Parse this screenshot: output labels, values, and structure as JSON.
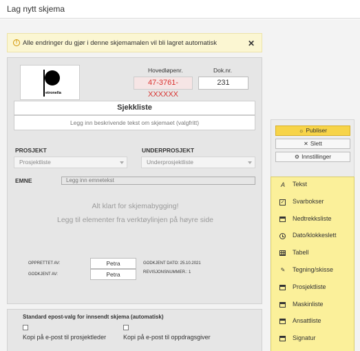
{
  "window": {
    "title": "Lag nytt skjema"
  },
  "notice": {
    "text": "Alle endringer du gjør i denne skjemamalen vil bli lagret automatisk",
    "close": "✕"
  },
  "form": {
    "logo_text": "etronella",
    "hovedlopenr_label": "Hovedløpenr.",
    "hovedlopenr_value": "47-3761-XXXXXX",
    "doknr_label": "Dok.nr.",
    "doknr_value": "231",
    "title_value": "Sjekkliste",
    "description_placeholder": "Legg inn beskrivende tekst om skjemaet (valgfritt)",
    "prosjekt_label": "PROSJEKT",
    "prosjekt_value": "Prosjektliste",
    "underprosjekt_label": "UNDERPROSJEKT",
    "underprosjekt_value": "Underprosjektliste",
    "emne_label": "EMNE",
    "emne_placeholder": "Legg inn emnetekst",
    "empty_line1": "Alt klart for skjemabygging!",
    "empty_line2": "Legg til elementer fra verktøylinjen på høyre side",
    "opprettet_label": "OPPRETTET AV:",
    "opprettet_value": "Petra",
    "godkjent_label": "GODKJENT AV:",
    "godkjent_value": "Petra",
    "godkjent_dato": "GODKJENT DATO: 25.10.2021",
    "revisjonsnummer": "REVISJONSNUMMER.: 1"
  },
  "email": {
    "heading": "Standard epost-valg for innsendt skjema (automatisk)",
    "option1": "Kopi på e-post til prosjektleder",
    "option2": "Kopi på e-post til oppdragsgiver"
  },
  "actions": {
    "publish": "Publiser",
    "delete": "Slett",
    "settings": "Innstillinger"
  },
  "toolbox": {
    "items": [
      {
        "label": "Tekst",
        "icon": "text-icon"
      },
      {
        "label": "Svarbokser",
        "icon": "checkbox-icon"
      },
      {
        "label": "Nedtrekksliste",
        "icon": "table-icon"
      },
      {
        "label": "Dato/klokkeslett",
        "icon": "clock-icon"
      },
      {
        "label": "Tabell",
        "icon": "grid-icon"
      },
      {
        "label": "Tegning/skisse",
        "icon": "pencil-icon"
      },
      {
        "label": "Prosjektliste",
        "icon": "table-icon"
      },
      {
        "label": "Maskinliste",
        "icon": "table-icon"
      },
      {
        "label": "Ansattliste",
        "icon": "table-icon"
      },
      {
        "label": "Signatur",
        "icon": "table-icon"
      }
    ]
  },
  "colors": {
    "accent": "#f7d449",
    "toolbox_bg": "#fbf09a",
    "notice_bg": "#fbf6d2",
    "error_text": "#d9322f"
  }
}
